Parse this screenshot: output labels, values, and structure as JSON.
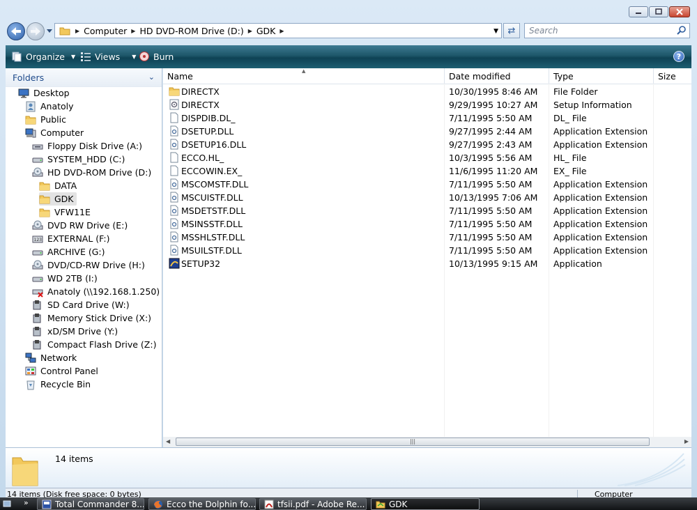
{
  "window": {
    "title": "GDK"
  },
  "title_buttons": {
    "minimize": "minimize",
    "maximize": "maximize",
    "close": "close"
  },
  "address": {
    "segments": [
      "Computer",
      "HD DVD-ROM Drive (D:)",
      "GDK"
    ]
  },
  "search": {
    "placeholder": "Search"
  },
  "toolbar": {
    "organize": "Organize",
    "views": "Views",
    "burn": "Burn"
  },
  "folders_pane": {
    "header": "Folders",
    "items": [
      {
        "label": "Desktop",
        "icon": "desktop-icon"
      },
      {
        "label": "Anatoly",
        "icon": "user-folder-icon"
      },
      {
        "label": "Public",
        "icon": "folder-icon"
      },
      {
        "label": "Computer",
        "icon": "computer-icon"
      },
      {
        "label": "Floppy Disk Drive (A:)",
        "icon": "floppy-drive-icon"
      },
      {
        "label": "SYSTEM_HDD (C:)",
        "icon": "hard-drive-icon"
      },
      {
        "label": "HD DVD-ROM Drive (D:)",
        "icon": "dvd-drive-icon"
      },
      {
        "label": "DATA",
        "icon": "folder-icon"
      },
      {
        "label": "GDK",
        "icon": "folder-icon",
        "selected": true
      },
      {
        "label": "VFW11E",
        "icon": "folder-icon"
      },
      {
        "label": "DVD RW Drive (E:)",
        "icon": "dvd-drive-icon"
      },
      {
        "label": "EXTERNAL (F:)",
        "icon": "external-drive-icon"
      },
      {
        "label": "ARCHIVE (G:)",
        "icon": "hard-drive-icon"
      },
      {
        "label": "DVD/CD-RW Drive (H:)",
        "icon": "dvd-drive-icon"
      },
      {
        "label": "WD 2TB (I:)",
        "icon": "hard-drive-icon"
      },
      {
        "label": "Anatoly (\\\\192.168.1.250) (R:)",
        "icon": "disconnected-network-drive-icon"
      },
      {
        "label": "SD Card Drive (W:)",
        "icon": "card-reader-icon"
      },
      {
        "label": "Memory Stick Drive (X:)",
        "icon": "card-reader-icon"
      },
      {
        "label": "xD/SM Drive (Y:)",
        "icon": "card-reader-icon"
      },
      {
        "label": "Compact Flash Drive (Z:)",
        "icon": "card-reader-icon"
      },
      {
        "label": "Network",
        "icon": "network-icon"
      },
      {
        "label": "Control Panel",
        "icon": "control-panel-icon"
      },
      {
        "label": "Recycle Bin",
        "icon": "recycle-bin-icon"
      }
    ]
  },
  "columns": {
    "name": "Name",
    "date": "Date modified",
    "type": "Type",
    "size": "Size"
  },
  "files": [
    {
      "name": "DIRECTX",
      "date": "10/30/1995 8:46 AM",
      "type": "File Folder",
      "icon": "folder-icon"
    },
    {
      "name": "DIRECTX",
      "date": "9/29/1995 10:27 AM",
      "type": "Setup Information",
      "icon": "setup-info-icon"
    },
    {
      "name": "DISPDIB.DL_",
      "date": "7/11/1995 5:50 AM",
      "type": "DL_ File",
      "icon": "file-icon"
    },
    {
      "name": "DSETUP.DLL",
      "date": "9/27/1995 2:44 AM",
      "type": "Application Extension",
      "icon": "dll-icon"
    },
    {
      "name": "DSETUP16.DLL",
      "date": "9/27/1995 2:43 AM",
      "type": "Application Extension",
      "icon": "dll-icon"
    },
    {
      "name": "ECCO.HL_",
      "date": "10/3/1995 5:56 AM",
      "type": "HL_ File",
      "icon": "file-icon"
    },
    {
      "name": "ECCOWIN.EX_",
      "date": "11/6/1995 11:20 AM",
      "type": "EX_ File",
      "icon": "file-icon"
    },
    {
      "name": "MSCOMSTF.DLL",
      "date": "7/11/1995 5:50 AM",
      "type": "Application Extension",
      "icon": "dll-icon"
    },
    {
      "name": "MSCUISTF.DLL",
      "date": "10/13/1995 7:06 AM",
      "type": "Application Extension",
      "icon": "dll-icon"
    },
    {
      "name": "MSDETSTF.DLL",
      "date": "7/11/1995 5:50 AM",
      "type": "Application Extension",
      "icon": "dll-icon"
    },
    {
      "name": "MSINSSTF.DLL",
      "date": "7/11/1995 5:50 AM",
      "type": "Application Extension",
      "icon": "dll-icon"
    },
    {
      "name": "MSSHLSTF.DLL",
      "date": "7/11/1995 5:50 AM",
      "type": "Application Extension",
      "icon": "dll-icon"
    },
    {
      "name": "MSUILSTF.DLL",
      "date": "7/11/1995 5:50 AM",
      "type": "Application Extension",
      "icon": "dll-icon"
    },
    {
      "name": "SETUP32",
      "date": "10/13/1995 9:15 AM",
      "type": "Application",
      "icon": "application-icon"
    }
  ],
  "details": {
    "count": "14 items"
  },
  "statusbar": {
    "left": "14 items (Disk free space: 0 bytes)",
    "right": "Computer"
  },
  "taskbar": {
    "tasks": [
      {
        "label": "Total Commander 8...",
        "icon": "total-commander-icon"
      },
      {
        "label": "Ecco the Dolphin fo...",
        "icon": "firefox-icon"
      },
      {
        "label": "tfsii.pdf - Adobe Re...",
        "icon": "adobe-reader-icon"
      },
      {
        "label": "GDK",
        "icon": "explorer-folder-icon",
        "active": true
      }
    ]
  },
  "colors": {
    "toolbar": "#1d5669",
    "accent": "#1e4a8a",
    "folder": "#f2c85b"
  }
}
